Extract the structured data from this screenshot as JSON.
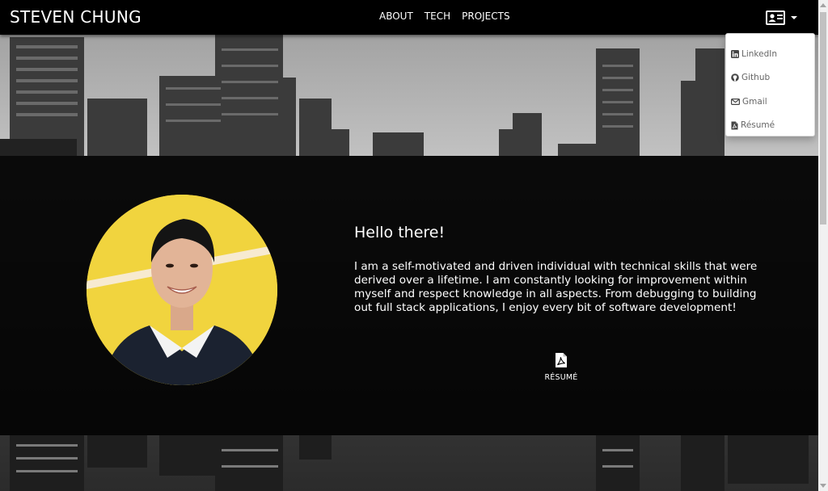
{
  "brand": "STEVEN CHUNG",
  "nav": {
    "links": [
      "ABOUT",
      "TECH",
      "PROJECTS"
    ]
  },
  "contact_menu": {
    "icon": "contact-card-icon",
    "items": [
      {
        "label": "LinkedIn",
        "icon": "linkedin-icon"
      },
      {
        "label": "Github",
        "icon": "github-icon"
      },
      {
        "label": "Gmail",
        "icon": "envelope-icon"
      },
      {
        "label": "Résumé",
        "icon": "pdf-file-icon"
      }
    ]
  },
  "intro": {
    "greeting": "Hello there!",
    "bio": "I am a self-motivated and driven individual with technical skills that were derived over a lifetime. I am constantly looking for improvement within myself and respect knowledge in all aspects. From debugging to building out full stack applications, I enjoy every bit of software development!",
    "resume_label": "RÉSUMÉ",
    "resume_icon": "pdf-file-icon"
  },
  "colors": {
    "navbar": "#000000",
    "overlay": "#000000",
    "portrait_bg": "#f1d43e",
    "text": "#ffffff",
    "dropdown_text": "#666666"
  }
}
